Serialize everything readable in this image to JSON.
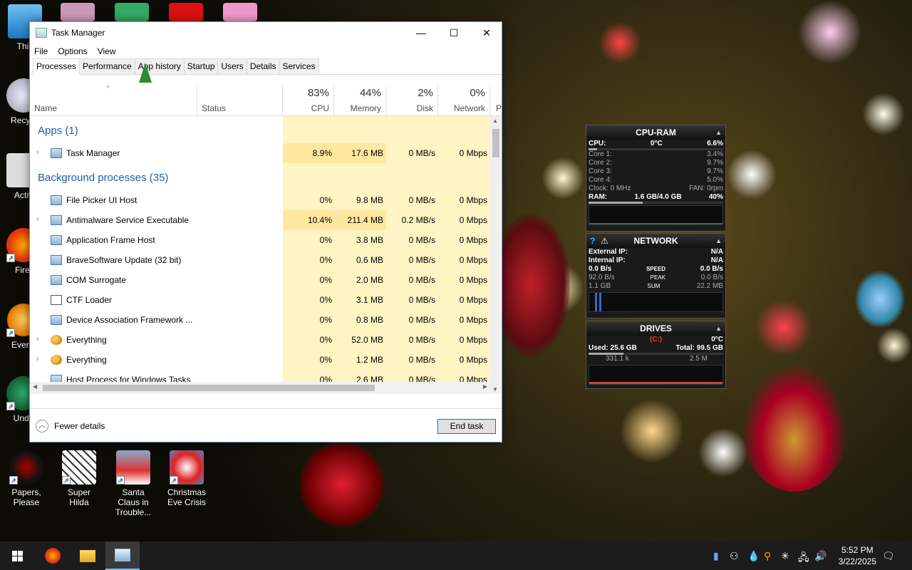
{
  "window": {
    "title": "Task Manager",
    "minimize": "—",
    "maximize": "☐",
    "close": "✕"
  },
  "menu": [
    "File",
    "Options",
    "View"
  ],
  "tabs": [
    "Processes",
    "Performance",
    "App history",
    "Startup",
    "Users",
    "Details",
    "Services"
  ],
  "columns": {
    "name": "Name",
    "status": "Status",
    "cpu": {
      "pct": "83%",
      "label": "CPU"
    },
    "memory": {
      "pct": "44%",
      "label": "Memory"
    },
    "disk": {
      "pct": "2%",
      "label": "Disk"
    },
    "network": {
      "pct": "0%",
      "label": "Network"
    },
    "power": "P"
  },
  "groups": {
    "apps": "Apps (1)",
    "background": "Background processes (35)"
  },
  "rows": [
    {
      "name": "Task Manager",
      "cpu": "8.9%",
      "mem": "17.6 MB",
      "disk": "0 MB/s",
      "net": "0 Mbps"
    },
    {
      "name": "File Picker UI Host",
      "cpu": "0%",
      "mem": "9.8 MB",
      "disk": "0 MB/s",
      "net": "0 Mbps"
    },
    {
      "name": "Antimalware Service Executable",
      "cpu": "10.4%",
      "mem": "211.4 MB",
      "disk": "0.2 MB/s",
      "net": "0 Mbps"
    },
    {
      "name": "Application Frame Host",
      "cpu": "0%",
      "mem": "3.8 MB",
      "disk": "0 MB/s",
      "net": "0 Mbps"
    },
    {
      "name": "BraveSoftware Update (32 bit)",
      "cpu": "0%",
      "mem": "0.6 MB",
      "disk": "0 MB/s",
      "net": "0 Mbps"
    },
    {
      "name": "COM Surrogate",
      "cpu": "0%",
      "mem": "2.0 MB",
      "disk": "0 MB/s",
      "net": "0 Mbps"
    },
    {
      "name": "CTF Loader",
      "cpu": "0%",
      "mem": "3.1 MB",
      "disk": "0 MB/s",
      "net": "0 Mbps"
    },
    {
      "name": "Device Association Framework ...",
      "cpu": "0%",
      "mem": "0.8 MB",
      "disk": "0 MB/s",
      "net": "0 Mbps"
    },
    {
      "name": "Everything",
      "cpu": "0%",
      "mem": "52.0 MB",
      "disk": "0 MB/s",
      "net": "0 Mbps"
    },
    {
      "name": "Everything",
      "cpu": "0%",
      "mem": "1.2 MB",
      "disk": "0 MB/s",
      "net": "0 Mbps"
    },
    {
      "name": "Host Process for Windows Tasks",
      "cpu": "0%",
      "mem": "2.6 MB",
      "disk": "0 MB/s",
      "net": "0 Mbps"
    }
  ],
  "footer": {
    "fewer": "Fewer details",
    "end_task": "End task"
  },
  "gadget": {
    "cpu_title": "CPU-RAM",
    "cpu_label": "CPU:",
    "cpu_temp": "0°C",
    "cpu_pct": "6.6%",
    "cores": [
      {
        "label": "Core 1:",
        "value": "3.4%"
      },
      {
        "label": "Core 2:",
        "value": "9.7%"
      },
      {
        "label": "Core 3:",
        "value": "9.7%"
      },
      {
        "label": "Core 4:",
        "value": "5.0%"
      }
    ],
    "clock": "Clock: 0 MHz",
    "fan": "FAN: 0rpm",
    "ram_label": "RAM:",
    "ram_value": "1.6 GB/4.0 GB",
    "ram_pct": "40%",
    "net_title": "NETWORK",
    "ext_ip_label": "External IP:",
    "ext_ip": "N/A",
    "int_ip_label": "Internal IP:",
    "int_ip": "N/A",
    "speed_left": "0.0 B/s",
    "speed_label": "SPEED",
    "speed_right": "0.0 B/s",
    "peak_left": "92.0 B/s",
    "peak_label": "PEAK",
    "peak_right": "0.0 B/s",
    "sum_left": "1.1 GB",
    "sum_label": "SUM",
    "sum_right": "22.2 MB",
    "drives_title": "DRIVES",
    "drive": "(C:)",
    "drive_temp": "0°C",
    "used": "Used: 25.6 GB",
    "total": "Total: 99.5 GB",
    "read": "331.1 k",
    "write": "2.5 M"
  },
  "desktop_icons": [
    {
      "label": "This"
    },
    {
      "label": "Recycl"
    },
    {
      "label": "Activ"
    },
    {
      "label": "Firef"
    },
    {
      "label": "Everyt"
    },
    {
      "label": "Unde"
    },
    {
      "label": "Papers, Please"
    },
    {
      "label": "Super Hilda"
    },
    {
      "label": "Santa Claus in Trouble..."
    },
    {
      "label": "Christmas Eve Crisis"
    }
  ],
  "taskbar": {
    "time": "5:52 PM",
    "date": "3/22/2025"
  }
}
